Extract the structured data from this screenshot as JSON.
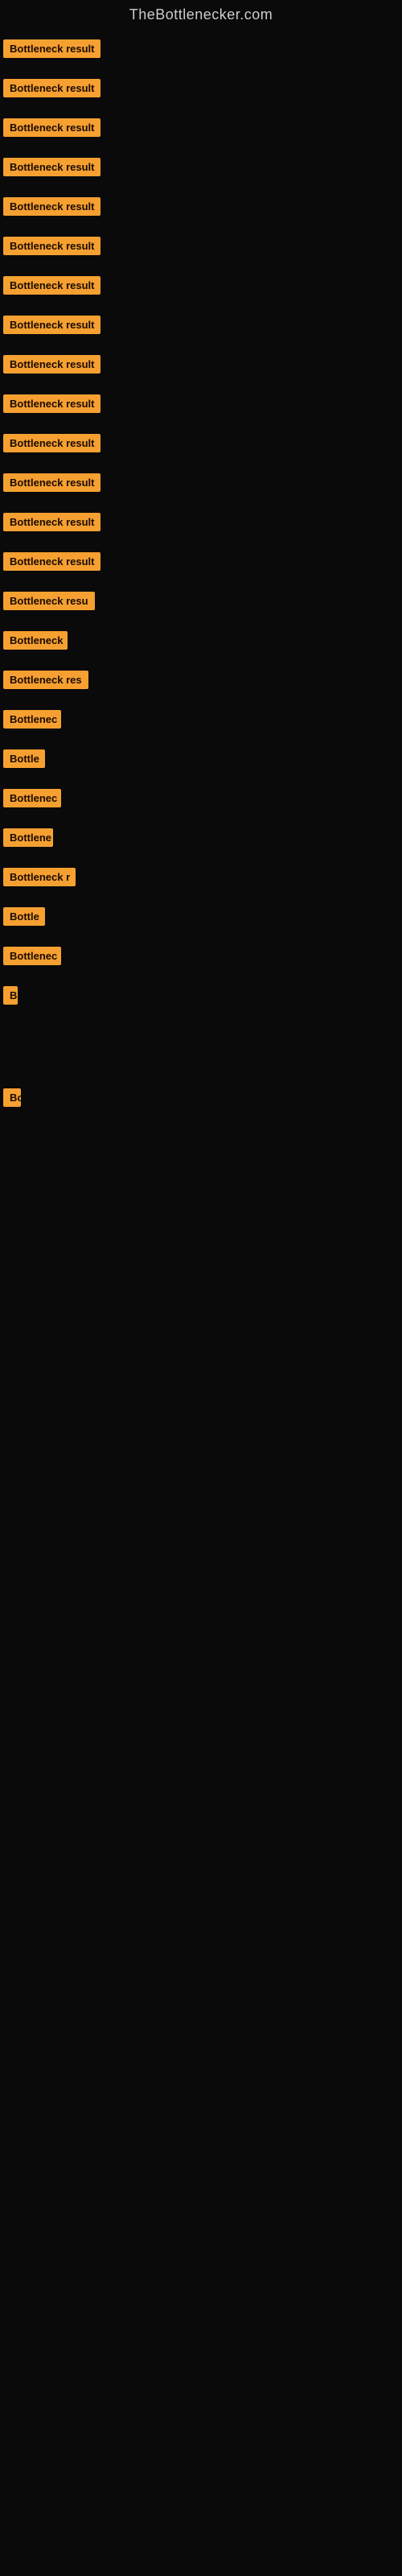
{
  "site": {
    "title": "TheBottlenecker.com"
  },
  "rows": [
    {
      "label": "Bottleneck result",
      "width": 140
    },
    {
      "label": "Bottleneck result",
      "width": 140
    },
    {
      "label": "Bottleneck result",
      "width": 140
    },
    {
      "label": "Bottleneck result",
      "width": 140
    },
    {
      "label": "Bottleneck result",
      "width": 140
    },
    {
      "label": "Bottleneck result",
      "width": 140
    },
    {
      "label": "Bottleneck result",
      "width": 140
    },
    {
      "label": "Bottleneck result",
      "width": 140
    },
    {
      "label": "Bottleneck result",
      "width": 140
    },
    {
      "label": "Bottleneck result",
      "width": 140
    },
    {
      "label": "Bottleneck result",
      "width": 140
    },
    {
      "label": "Bottleneck result",
      "width": 140
    },
    {
      "label": "Bottleneck result",
      "width": 140
    },
    {
      "label": "Bottleneck result",
      "width": 140
    },
    {
      "label": "Bottleneck resu",
      "width": 118
    },
    {
      "label": "Bottleneck",
      "width": 80
    },
    {
      "label": "Bottleneck res",
      "width": 107
    },
    {
      "label": "Bottlenec",
      "width": 72
    },
    {
      "label": "Bottle",
      "width": 52
    },
    {
      "label": "Bottlenec",
      "width": 72
    },
    {
      "label": "Bottlene",
      "width": 62
    },
    {
      "label": "Bottleneck r",
      "width": 90
    },
    {
      "label": "Bottle",
      "width": 52
    },
    {
      "label": "Bottlenec",
      "width": 72
    },
    {
      "label": "B",
      "width": 18
    },
    {
      "label": "",
      "width": 0
    },
    {
      "label": "",
      "width": 0
    },
    {
      "label": "",
      "width": 0
    },
    {
      "label": "Bo",
      "width": 22
    },
    {
      "label": "",
      "width": 0
    },
    {
      "label": "",
      "width": 0
    },
    {
      "label": "",
      "width": 0
    }
  ]
}
